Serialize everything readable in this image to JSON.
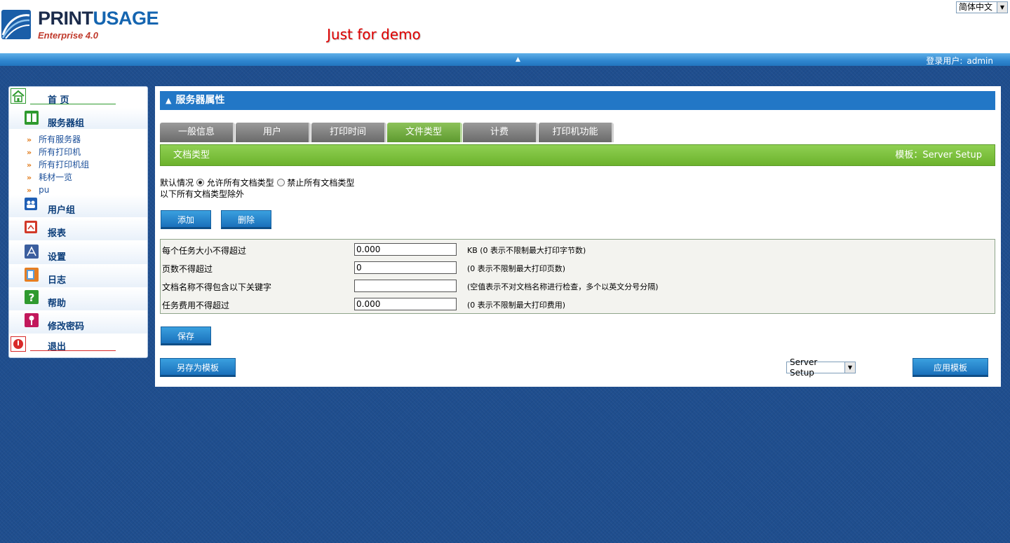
{
  "header": {
    "logo_main": "PRINT",
    "logo_accent": "USAGE",
    "logo_sub": "Enterprise 4.0",
    "demo_text": "Just for demo",
    "language": "简体中文"
  },
  "topbar": {
    "login_label": "登录用户:",
    "login_user": "admin"
  },
  "sidebar": {
    "home": "首 页",
    "server_group": "服务器组",
    "server_group_items": [
      "所有服务器",
      "所有打印机",
      "所有打印机组",
      "耗材一览",
      "pu"
    ],
    "user_group": "用户组",
    "reports": "报表",
    "settings": "设置",
    "logs": "日志",
    "help": "帮助",
    "change_password": "修改密码",
    "logout": "退出"
  },
  "panel": {
    "title": "服务器属性",
    "tabs": [
      "一般信息",
      "用户",
      "打印时间",
      "文件类型",
      "计费",
      "打印机功能"
    ],
    "active_tab": "文件类型",
    "subhead_left": "文档类型",
    "subhead_right": "模板：Server Setup",
    "default_label": "默认情况",
    "radio_allow": "允许所有文档类型",
    "radio_deny": "禁止所有文档类型",
    "except_text": "以下所有文档类型除外",
    "add_button": "添加",
    "delete_button": "删除",
    "rows": [
      {
        "label": "每个任务大小不得超过",
        "value": "0.000",
        "hint": "KB (0 表示不限制最大打印字节数)"
      },
      {
        "label": "页数不得超过",
        "value": "0",
        "hint": "(0 表示不限制最大打印页数)"
      },
      {
        "label": "文档名称不得包含以下关键字",
        "value": "",
        "hint": "(空值表示不对文档名称进行检查，多个以英文分号分隔)"
      },
      {
        "label": "任务费用不得超过",
        "value": "0.000",
        "hint": "(0 表示不限制最大打印费用)"
      }
    ],
    "save_button": "保存",
    "save_template_button": "另存为模板",
    "template_select": "Server Setup",
    "apply_template_button": "应用模板"
  },
  "colors": {
    "title_blue": "#2277c6",
    "tab_active_green": "#6cb22c",
    "button_blue": "#1a70bb",
    "demo_red": "#e00000"
  }
}
